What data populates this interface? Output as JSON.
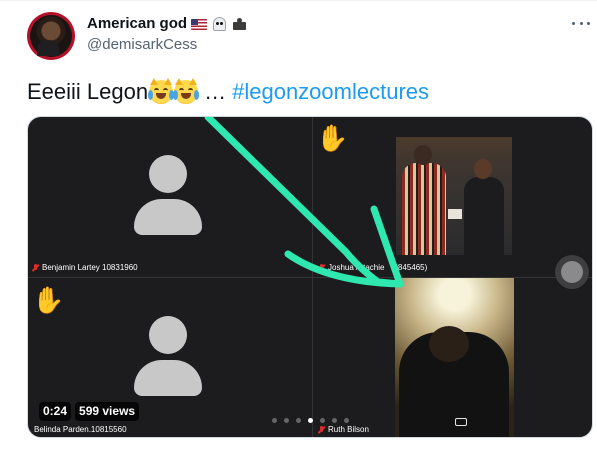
{
  "tweet": {
    "author_name": "American god",
    "badges": [
      "us-flag-icon",
      "ghost-icon",
      "crown-icon"
    ],
    "handle": "@demisarkCess",
    "text_before": "Eeeiii Legon",
    "emojis": [
      "crying-cat-emoji",
      "crying-cat-emoji"
    ],
    "text_ellipsis": "…",
    "hashtag": "#legonzoomlectures"
  },
  "media": {
    "type": "video",
    "participants": [
      {
        "label": "Benjamin Lartey 10831960",
        "muted": true
      },
      {
        "label": "Joshua Attachie",
        "label_suffix": "0845465)",
        "muted": true
      },
      {
        "label": "Belinda Parden.10815560",
        "muted": false
      },
      {
        "label": "Ruth Bilson",
        "muted": true
      }
    ],
    "raised_hands": [
      "hand-raised-icon",
      "hand-raised-icon"
    ],
    "pager_dots": 7,
    "active_dot": 3,
    "duration": "0:24",
    "views": "599 views"
  },
  "colors": {
    "link": "#1d9bf0",
    "arrow": "#2ee8b0",
    "muted_mic": "#e02b2b",
    "secondary_text": "#536471"
  }
}
